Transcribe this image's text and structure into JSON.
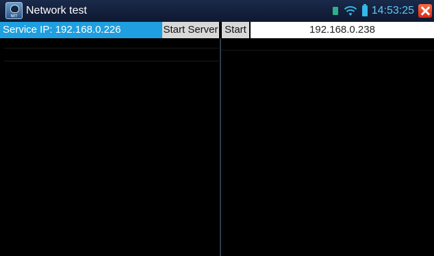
{
  "app": {
    "title": "Network test",
    "icon_label": "NET",
    "icon": "network-test-app-icon"
  },
  "status_bar": {
    "time": "14:53:25",
    "icons": [
      "sim-icon",
      "wifi-icon",
      "battery-icon",
      "close-icon"
    ]
  },
  "toolbar": {
    "service_ip_label": "Service IP: 192.168.0.226",
    "start_server_label": "Start Server",
    "start_label": "Start",
    "target_ip_value": "192.168.0.238"
  },
  "colors": {
    "title_bar": "#14213d",
    "service_ip_bg": "#1f9fe0",
    "button_bg": "#d8d8d8",
    "clock": "#5fc9f5",
    "close": "#e0341f",
    "background": "#000000"
  }
}
